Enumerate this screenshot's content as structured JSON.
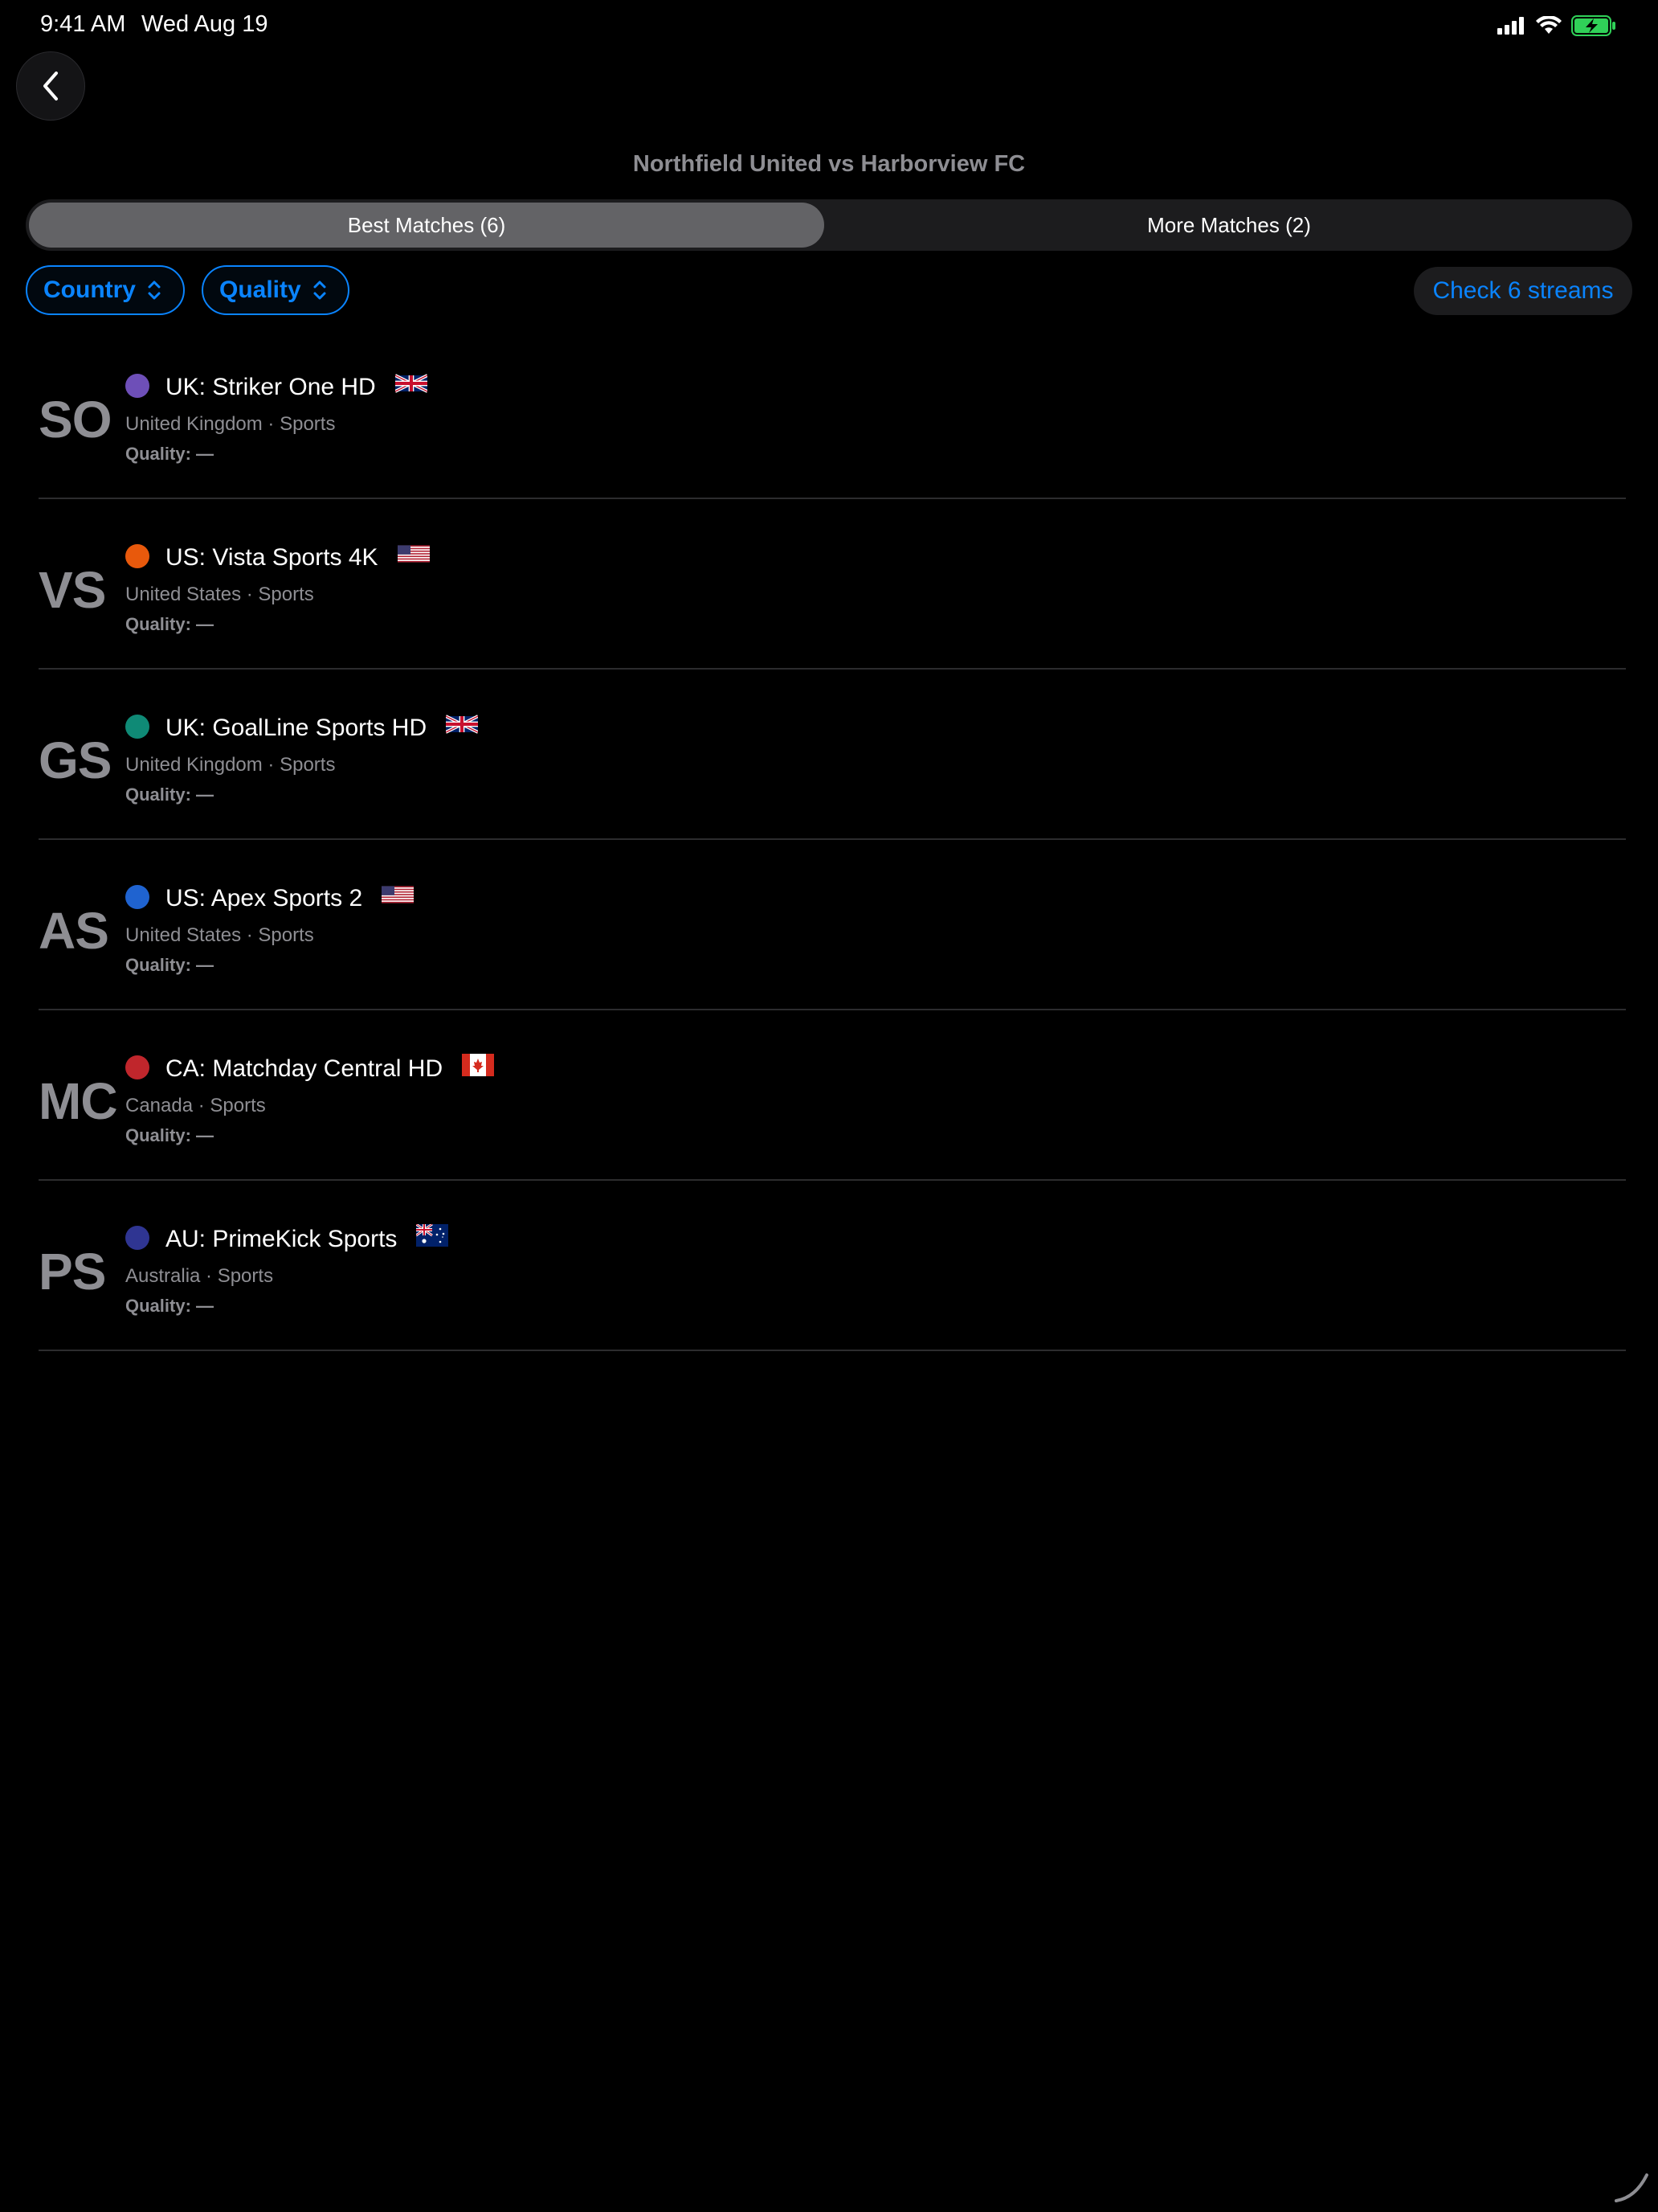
{
  "status_bar": {
    "time": "9:41 AM",
    "date": "Wed Aug 19"
  },
  "header": {
    "title": "Northfield United vs Harborview FC"
  },
  "tabs": [
    {
      "label": "Best Matches (6)",
      "active": true
    },
    {
      "label": "More Matches (2)",
      "active": false
    }
  ],
  "filters": {
    "country_label": "Country",
    "quality_label": "Quality",
    "check_label": "Check 6 streams"
  },
  "colors": {
    "accent": "#0a84ff",
    "battery": "#30d158"
  },
  "streams": [
    {
      "initials": "SO",
      "name": "UK: Striker One HD",
      "meta": "United Kingdom · Sports",
      "quality": "Quality: —",
      "dot_color": "#6e4fb8",
      "flag": "uk-flag-icon"
    },
    {
      "initials": "VS",
      "name": "US: Vista Sports 4K",
      "meta": "United States · Sports",
      "quality": "Quality: —",
      "dot_color": "#e8590c",
      "flag": "us-flag-icon"
    },
    {
      "initials": "GS",
      "name": "UK: GoalLine Sports HD",
      "meta": "United Kingdom · Sports",
      "quality": "Quality: —",
      "dot_color": "#0f8a76",
      "flag": "uk-flag-icon"
    },
    {
      "initials": "AS",
      "name": "US: Apex Sports 2",
      "meta": "United States · Sports",
      "quality": "Quality: —",
      "dot_color": "#1f63d0",
      "flag": "us-flag-icon"
    },
    {
      "initials": "MC",
      "name": "CA: Matchday Central HD",
      "meta": "Canada · Sports",
      "quality": "Quality: —",
      "dot_color": "#c0262c",
      "flag": "ca-flag-icon"
    },
    {
      "initials": "PS",
      "name": "AU: PrimeKick Sports",
      "meta": "Australia · Sports",
      "quality": "Quality: —",
      "dot_color": "#2f3592",
      "flag": "au-flag-icon"
    }
  ]
}
